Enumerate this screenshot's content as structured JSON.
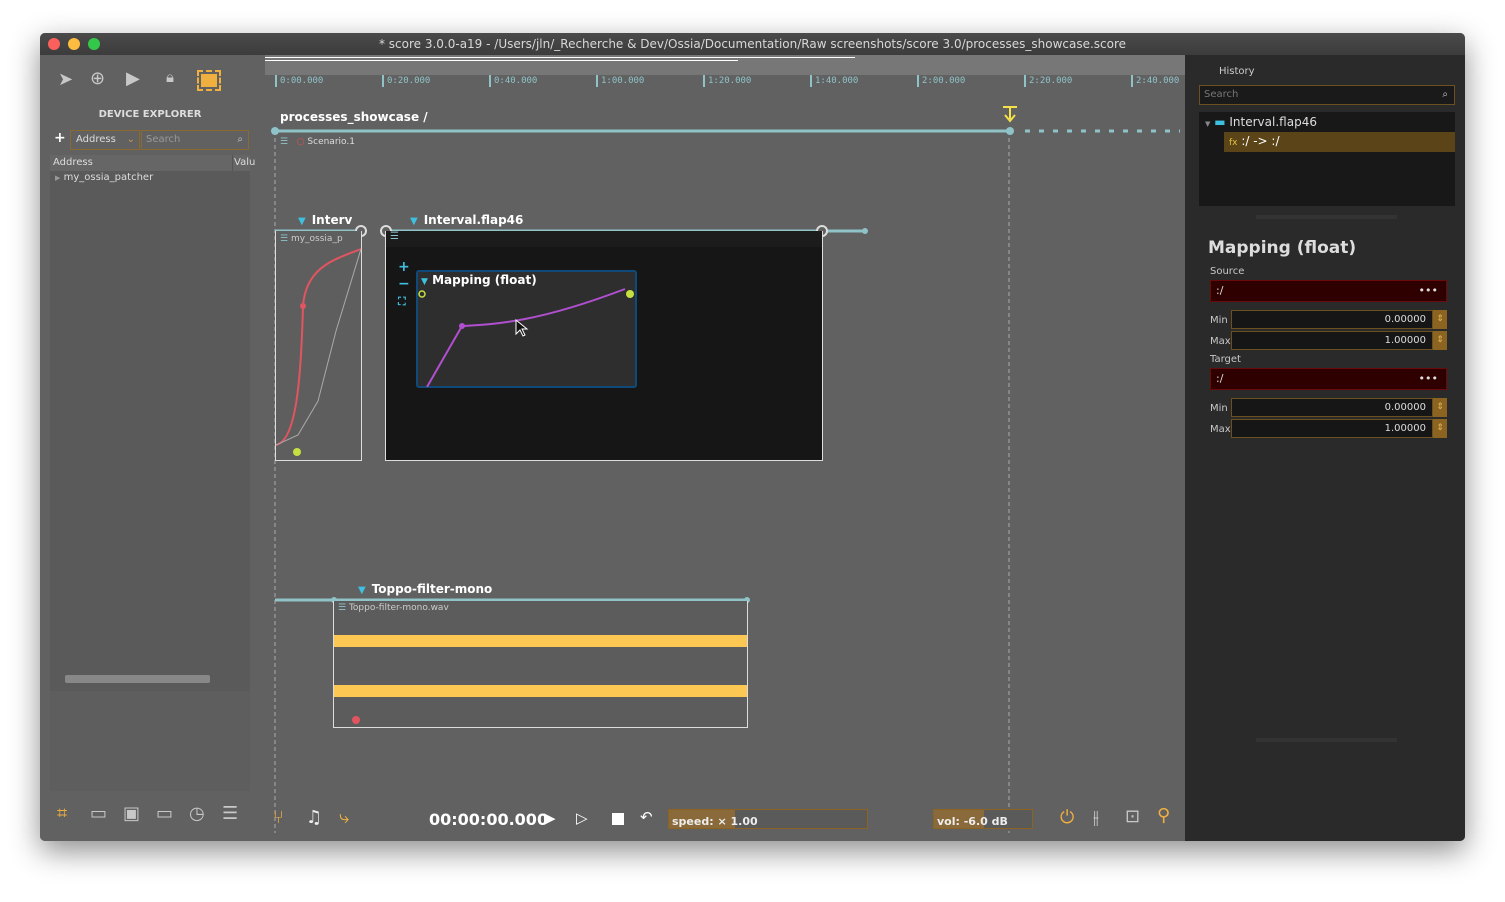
{
  "window": {
    "title": "* score 3.0.0-a19 - /Users/jln/_Recherche & Dev/Ossia/Documentation/Raw screenshots/score 3.0/processes_showcase.score"
  },
  "left_toolbar": {
    "icons": [
      "pointer-icon",
      "add-circle-icon",
      "play-icon",
      "lock-icon",
      "select-all-icon"
    ]
  },
  "device_explorer": {
    "title": "DEVICE EXPLORER",
    "add": "+",
    "column_select": "Address",
    "search_placeholder": "Search",
    "columns": [
      "Address",
      "Valu"
    ],
    "items": [
      "my_ossia_patcher"
    ]
  },
  "left_bottom_icons": [
    "fit-icon",
    "curve-icon",
    "user-folder-icon",
    "folder-icon",
    "history-icon",
    "list-icon"
  ],
  "timeline": {
    "ticks": [
      "0:00.000",
      "0:20.000",
      "0:40.000",
      "1:00.000",
      "1:20.000",
      "1:40.000",
      "2:00.000",
      "2:20.000",
      "2:40.000"
    ]
  },
  "scenario": {
    "breadcrumb": "processes_showcase /",
    "name": "Scenario.1",
    "intervals": [
      {
        "title": "Interv",
        "process": "my_ossia_p"
      },
      {
        "title": "Interval.flap46",
        "process": "Mapping (float)"
      },
      {
        "title": "Toppo-filter-mono",
        "process": "Toppo-filter-mono.wav"
      }
    ]
  },
  "transport": {
    "time": "00:00:00.000",
    "speed_label": "speed: × 1.00",
    "speed": 1.0,
    "volume_label": "vol: -6.0 dB",
    "volume_db": -6.0
  },
  "history": {
    "title": "History",
    "search_placeholder": "Search",
    "items": [
      {
        "label": "Interval.flap46"
      },
      {
        "label": ":/ -> :/",
        "icon": "fx"
      }
    ]
  },
  "inspector": {
    "title": "Mapping (float)",
    "source": {
      "label": "Source",
      "address": ":/",
      "min_label": "Min",
      "min": "0.00000",
      "max_label": "Max",
      "max": "1.00000"
    },
    "target": {
      "label": "Target",
      "address": ":/",
      "min_label": "Min",
      "min": "0.00000",
      "max_label": "Max",
      "max": "1.00000"
    },
    "more": "•••"
  },
  "colors": {
    "accent": "#f0b040",
    "interval": "#8fc3c8",
    "mapping": "#b050d0",
    "waveform": "#fcc752",
    "error": "#2e0000"
  }
}
